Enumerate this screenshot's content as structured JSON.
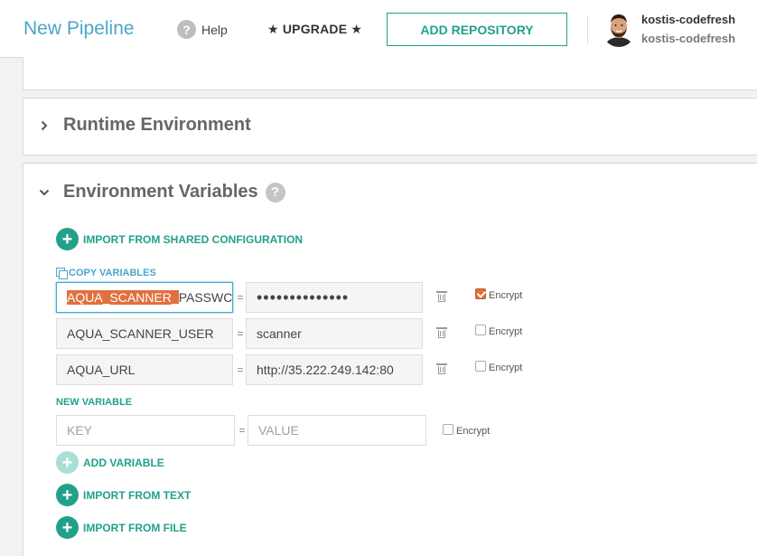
{
  "header": {
    "title": "New Pipeline",
    "help_label": "Help",
    "upgrade_label": "★ UPGRADE ★",
    "add_repository_label": "ADD REPOSITORY",
    "user": {
      "name": "kostis-codefresh",
      "account": "kostis-codefresh"
    }
  },
  "sections": {
    "runtime": {
      "title": "Runtime Environment",
      "expanded": false
    },
    "env": {
      "title": "Environment Variables",
      "expanded": true
    }
  },
  "env": {
    "import_shared_label": "IMPORT FROM SHARED CONFIGURATION",
    "copy_variables_label": "COPY VARIABLES",
    "variables": [
      {
        "key_selected": "AQUA_SCANNER_",
        "key_rest": "PASSWC",
        "value": "••••••••••••••",
        "encrypt_label": "Encrypt",
        "encrypted": true
      },
      {
        "key": "AQUA_SCANNER_USER",
        "value": "scanner",
        "encrypt_label": "Encrypt",
        "encrypted": false
      },
      {
        "key": "AQUA_URL",
        "value": "http://35.222.249.142:80",
        "encrypt_label": "Encrypt",
        "encrypted": false
      }
    ],
    "equals": "=",
    "new_variable_label": "NEW VARIABLE",
    "new_key_placeholder": "KEY",
    "new_value_placeholder": "VALUE",
    "new_encrypt_label": "Encrypt",
    "add_variable_label": "ADD VARIABLE",
    "import_text_label": "IMPORT FROM TEXT",
    "import_file_label": "IMPORT FROM FILE"
  },
  "colors": {
    "brand_blue": "#4aa6cd",
    "brand_green": "#23a08a",
    "selection_orange": "#e0703e"
  },
  "icons": [
    "help-icon",
    "chevron-right-icon",
    "chevron-down-icon",
    "question-icon",
    "plus-icon",
    "copy-icon",
    "trash-icon",
    "checkbox-icon"
  ]
}
